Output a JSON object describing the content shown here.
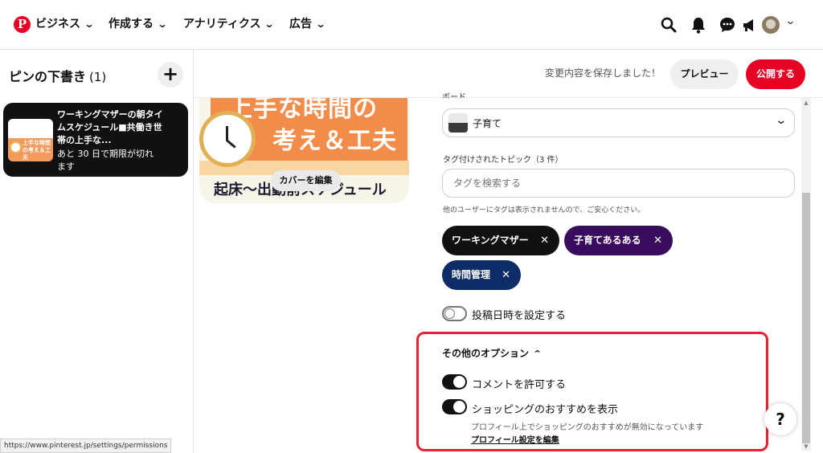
{
  "nav": {
    "logo_glyph": "P",
    "items": [
      {
        "label": "ビジネス"
      },
      {
        "label": "作成する"
      },
      {
        "label": "アナリティクス"
      },
      {
        "label": "広告"
      }
    ],
    "icons": [
      "search-icon",
      "bell-icon",
      "chat-icon",
      "megaphone-icon",
      "avatar",
      "chevron-down-icon"
    ]
  },
  "drafts": {
    "title": "ピンの下書き",
    "count": "(1)",
    "add_label": "+",
    "card": {
      "title": "ワーキングマザーの朝タイムスケジュール■共働き世帯の上手な...",
      "expiry": "あと 30 日で期限が切れます",
      "thumb_text": "上手な時間の考え＆工夫"
    }
  },
  "actionbar": {
    "saved_message": "変更内容を保存しました！",
    "preview_label": "プレビュー",
    "publish_label": "公開する"
  },
  "pin": {
    "top_text": "上手な時間の",
    "mid_text": "考え＆工夫",
    "bottom_text": "起床〜出勤前スケジュール",
    "cover_edit_label": "カバーを編集"
  },
  "form": {
    "board_label": "ボード",
    "board_value": "子育て",
    "topics_label": "タグ付けされたトピック（3 件）",
    "tag_placeholder": "タグを検索する",
    "tag_note": "他のユーザーにタグは表示されませんので、ご安心ください。",
    "tags": [
      {
        "label": "ワーキングマザー",
        "color": "#111111"
      },
      {
        "label": "子育てあるある",
        "color": "#3a0c5e"
      },
      {
        "label": "時間管理",
        "color": "#0e2c67"
      }
    ],
    "schedule_label": "投稿日時を設定する",
    "schedule_on": false
  },
  "options": {
    "title": "その他のオプション",
    "comments_label": "コメントを許可する",
    "comments_on": true,
    "shopping_label": "ショッピングのおすすめを表示",
    "shopping_on": true,
    "shopping_note": "プロフィール上でショッピングのおすすめが無効になっています",
    "profile_link": "プロフィール設定を編集",
    "highlight_color": "#e7212f"
  },
  "help_label": "?",
  "status_url": "https://www.pinterest.jp/settings/permissions",
  "colors": {
    "brand": "#e60023",
    "preview_bg": "#efefef"
  }
}
